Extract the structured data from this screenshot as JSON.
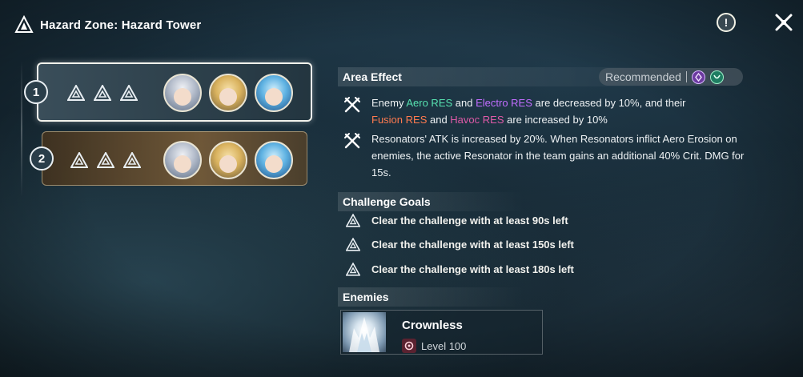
{
  "header": {
    "title": "Hazard Zone: Hazard Tower",
    "logo_icon": "tower-logo-icon",
    "info_icon": "exclamation-circle-icon",
    "info_glyph": "!",
    "close_icon": "close-x-icon"
  },
  "teams": [
    {
      "number": "1",
      "marks": 3,
      "selected": true,
      "avatars": [
        "resonator-silver-hair",
        "resonator-blonde",
        "resonator-blue-hair"
      ]
    },
    {
      "number": "2",
      "marks": 3,
      "selected": false,
      "avatars": [
        "resonator-silver-hair",
        "resonator-blonde",
        "resonator-blue-hair"
      ]
    }
  ],
  "area_effect": {
    "heading": "Area Effect",
    "recommended_label": "Recommended",
    "recommended_elements": [
      "electro",
      "aero"
    ],
    "effects": [
      {
        "icon": "crossed-swords-icon",
        "parts": [
          {
            "text": "Enemy ",
            "color": "default"
          },
          {
            "text": "Aero RES",
            "color": "aero"
          },
          {
            "text": " and ",
            "color": "default"
          },
          {
            "text": "Electro RES",
            "color": "electro"
          },
          {
            "text": " are decreased by 10%, and their ",
            "color": "default"
          },
          {
            "text": "Fusion RES",
            "color": "fusion"
          },
          {
            "text": " and ",
            "color": "default"
          },
          {
            "text": "Havoc RES",
            "color": "havoc"
          },
          {
            "text": " are increased by 10%",
            "color": "default"
          }
        ]
      },
      {
        "icon": "crossed-swords-icon",
        "parts": [
          {
            "text": "Resonators' ATK is increased by 20%. When Resonators inflict Aero Erosion on enemies, the active Resonator in the team gains an additional 40% Crit. DMG for 15s.",
            "color": "default"
          }
        ]
      }
    ]
  },
  "challenge_goals": {
    "heading": "Challenge Goals",
    "goals": [
      "Clear the challenge with at least 90s left",
      "Clear the challenge with at least 150s left",
      "Clear the challenge with at least 180s left"
    ]
  },
  "enemies": {
    "heading": "Enemies",
    "list": [
      {
        "name": "Crownless",
        "level": "Level 100",
        "level_icon": "havoc-element-icon"
      }
    ]
  },
  "colors": {
    "aero": "#57e2b0",
    "electro": "#c26dff",
    "fusion": "#ff7a4f",
    "havoc": "#e05aa8"
  }
}
